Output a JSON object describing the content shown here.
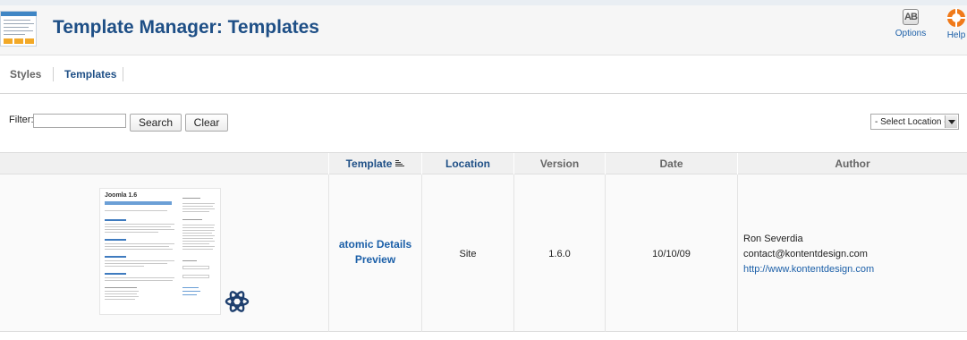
{
  "header": {
    "title": "Template Manager: Templates",
    "toolbar": {
      "options_label": "Options",
      "help_label": "Help"
    }
  },
  "subnav": {
    "tabs": [
      {
        "label": "Styles",
        "active": false
      },
      {
        "label": "Templates",
        "active": true
      }
    ]
  },
  "filter": {
    "label": "Filter:",
    "value": "",
    "search_label": "Search",
    "clear_label": "Clear",
    "location_select": "- Select Location -"
  },
  "table": {
    "columns": [
      "",
      "Template",
      "Location",
      "Version",
      "Date",
      "Author"
    ],
    "rows": [
      {
        "thumbnail_title": "Joomla 1.6",
        "name_line1": "atomic Details",
        "name_line2": "Preview",
        "location": "Site",
        "version": "1.6.0",
        "date": "10/10/09",
        "author_name": "Ron Severdia",
        "author_email": "contact@kontentdesign.com",
        "author_url": "http://www.kontentdesign.com"
      }
    ]
  },
  "colors": {
    "title": "#1e4f86",
    "link": "#1b5fa8",
    "help_orange": "#f07a1a"
  }
}
